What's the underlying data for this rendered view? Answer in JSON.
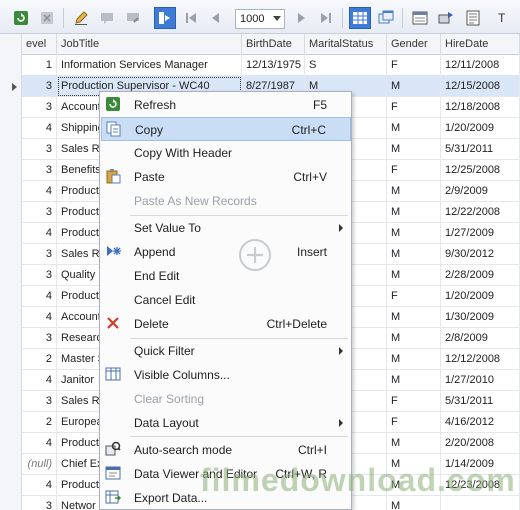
{
  "toolbar": {
    "page_size": "1000",
    "trailing_text": "T",
    "buttons": [
      "refresh-icon",
      "cancel-icon",
      "edit-icon",
      "comment-icon",
      "comment-edit-icon",
      "fetch-all-icon",
      "first-page-icon",
      "prev-page-icon",
      "next-page-icon",
      "last-page-icon",
      "grid-view-icon",
      "window-icon",
      "form-view-icon",
      "record-view-icon",
      "text-view-icon"
    ]
  },
  "grid": {
    "columns": [
      "evel",
      "JobTitle",
      "BirthDate",
      "MaritalStatus",
      "Gender",
      "HireDate"
    ],
    "rows": [
      {
        "level": "1",
        "jobtitle": "Information Services Manager",
        "birthdate": "12/13/1975",
        "marital": "S",
        "gender": "F",
        "hiredate": "12/11/2008"
      },
      {
        "level": "3",
        "jobtitle": "Production Supervisor - WC40",
        "birthdate": "8/27/1987",
        "marital": "M",
        "gender": "M",
        "hiredate": "12/15/2008"
      },
      {
        "level": "3",
        "jobtitle": "Account",
        "birthdate": "",
        "marital": "",
        "gender": "F",
        "hiredate": "12/18/2008"
      },
      {
        "level": "4",
        "jobtitle": "Shipping",
        "birthdate": "",
        "marital": "",
        "gender": "M",
        "hiredate": "1/20/2009"
      },
      {
        "level": "3",
        "jobtitle": "Sales Re",
        "birthdate": "",
        "marital": "",
        "gender": "M",
        "hiredate": "5/31/2011"
      },
      {
        "level": "3",
        "jobtitle": "Benefits",
        "birthdate": "",
        "marital": "",
        "gender": "F",
        "hiredate": "12/25/2008"
      },
      {
        "level": "4",
        "jobtitle": "Product",
        "birthdate": "",
        "marital": "",
        "gender": "M",
        "hiredate": "2/9/2009"
      },
      {
        "level": "3",
        "jobtitle": "Product",
        "birthdate": "",
        "marital": "",
        "gender": "M",
        "hiredate": "12/22/2008"
      },
      {
        "level": "4",
        "jobtitle": "Product",
        "birthdate": "",
        "marital": "",
        "gender": "M",
        "hiredate": "1/27/2009"
      },
      {
        "level": "3",
        "jobtitle": "Sales Re",
        "birthdate": "",
        "marital": "",
        "gender": "M",
        "hiredate": "9/30/2012"
      },
      {
        "level": "3",
        "jobtitle": "Quality",
        "birthdate": "",
        "marital": "",
        "gender": "M",
        "hiredate": "2/28/2009"
      },
      {
        "level": "4",
        "jobtitle": "Product",
        "birthdate": "",
        "marital": "",
        "gender": "F",
        "hiredate": "1/20/2009"
      },
      {
        "level": "4",
        "jobtitle": "Account",
        "birthdate": "",
        "marital": "",
        "gender": "M",
        "hiredate": "1/30/2009"
      },
      {
        "level": "3",
        "jobtitle": "Researc",
        "birthdate": "",
        "marital": "",
        "gender": "M",
        "hiredate": "2/8/2009"
      },
      {
        "level": "2",
        "jobtitle": "Master S",
        "birthdate": "",
        "marital": "",
        "gender": "M",
        "hiredate": "12/12/2008"
      },
      {
        "level": "4",
        "jobtitle": "Janitor",
        "birthdate": "",
        "marital": "",
        "gender": "M",
        "hiredate": "1/27/2010"
      },
      {
        "level": "3",
        "jobtitle": "Sales Re",
        "birthdate": "",
        "marital": "",
        "gender": "F",
        "hiredate": "5/31/2011"
      },
      {
        "level": "2",
        "jobtitle": "Europea",
        "birthdate": "",
        "marital": "",
        "gender": "F",
        "hiredate": "4/16/2012"
      },
      {
        "level": "4",
        "jobtitle": "Product",
        "birthdate": "",
        "marital": "",
        "gender": "M",
        "hiredate": "2/20/2008"
      },
      {
        "level": "(null)",
        "jobtitle": "Chief Ex",
        "birthdate": "",
        "marital": "",
        "gender": "M",
        "hiredate": "1/14/2009"
      },
      {
        "level": "4",
        "jobtitle": "Product",
        "birthdate": "",
        "marital": "",
        "gender": "M",
        "hiredate": "12/23/2008"
      },
      {
        "level": "3",
        "jobtitle": "Networ",
        "birthdate": "",
        "marital": "",
        "gender": "M",
        "hiredate": ""
      }
    ]
  },
  "context_menu": {
    "items": [
      {
        "label": "Refresh",
        "shortcut": "F5",
        "icon": "refresh-icon"
      },
      {
        "label": "Copy",
        "shortcut": "Ctrl+C",
        "icon": "copy-icon"
      },
      {
        "label": "Copy With Header",
        "shortcut": "",
        "icon": ""
      },
      {
        "label": "Paste",
        "shortcut": "Ctrl+V",
        "icon": "paste-icon"
      },
      {
        "label": "Paste As New Records",
        "shortcut": "",
        "icon": ""
      },
      {
        "label": "Set Value To",
        "shortcut": "",
        "icon": ""
      },
      {
        "label": "Append",
        "shortcut": "Insert",
        "icon": "append-icon"
      },
      {
        "label": "End Edit",
        "shortcut": "",
        "icon": ""
      },
      {
        "label": "Cancel Edit",
        "shortcut": "",
        "icon": ""
      },
      {
        "label": "Delete",
        "shortcut": "Ctrl+Delete",
        "icon": "delete-icon"
      },
      {
        "label": "Quick Filter",
        "shortcut": "",
        "icon": ""
      },
      {
        "label": "Visible Columns...",
        "shortcut": "",
        "icon": "columns-icon"
      },
      {
        "label": "Clear Sorting",
        "shortcut": "",
        "icon": ""
      },
      {
        "label": "Data Layout",
        "shortcut": "",
        "icon": ""
      },
      {
        "label": "Auto-search mode",
        "shortcut": "Ctrl+I",
        "icon": "search-mode-icon"
      },
      {
        "label": "Data Viewer and Editor",
        "shortcut": "Ctrl+W, R",
        "icon": "viewer-icon"
      },
      {
        "label": "Export Data...",
        "shortcut": "",
        "icon": "export-icon"
      }
    ]
  },
  "watermark": "filmedownload.com"
}
